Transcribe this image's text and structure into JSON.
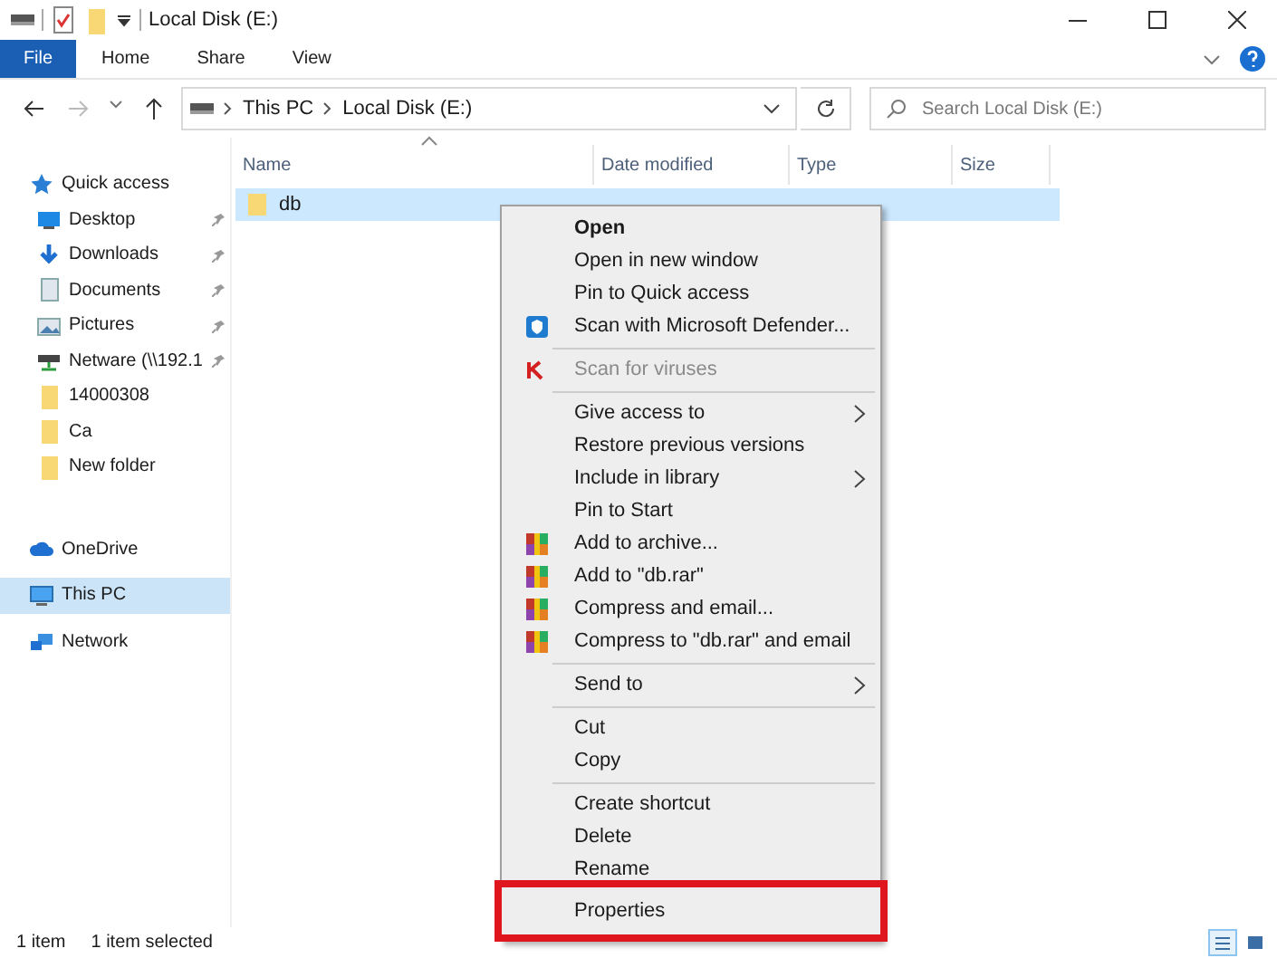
{
  "window": {
    "title": "Local Disk (E:)"
  },
  "ribbon_tabs": [
    {
      "label": "File",
      "selected": true
    },
    {
      "label": "Home",
      "selected": false
    },
    {
      "label": "Share",
      "selected": false
    },
    {
      "label": "View",
      "selected": false
    }
  ],
  "address_bar": {
    "crumbs": [
      "This PC",
      "Local Disk (E:)"
    ]
  },
  "search": {
    "placeholder": "Search Local Disk (E:)"
  },
  "nav_pane": [
    {
      "label": "Quick access",
      "kind": "star",
      "selected": false,
      "children": [
        {
          "label": "Desktop",
          "kind": "desktop",
          "pinned": true,
          "selected": false
        },
        {
          "label": "Downloads",
          "kind": "download",
          "pinned": true,
          "selected": false
        },
        {
          "label": "Documents",
          "kind": "document",
          "pinned": true,
          "selected": false
        },
        {
          "label": "Pictures",
          "kind": "pictures",
          "pinned": true,
          "selected": false
        },
        {
          "label": "Netware (\\\\192.1",
          "kind": "network-drive",
          "pinned": true,
          "selected": false
        },
        {
          "label": "14000308",
          "kind": "folder",
          "pinned": false,
          "selected": false
        },
        {
          "label": "Ca",
          "kind": "folder",
          "pinned": false,
          "selected": false
        },
        {
          "label": "New folder",
          "kind": "folder",
          "pinned": false,
          "selected": false
        }
      ]
    },
    {
      "label": "OneDrive",
      "kind": "cloud",
      "selected": false
    },
    {
      "label": "This PC",
      "kind": "computer",
      "selected": true
    },
    {
      "label": "Network",
      "kind": "network",
      "selected": false
    }
  ],
  "table": {
    "columns": [
      "Name",
      "Date modified",
      "Type",
      "Size"
    ],
    "rows": [
      {
        "name": "db",
        "selected": true
      }
    ]
  },
  "context_menu": [
    {
      "kind": "plain",
      "label": "Open",
      "default": true,
      "disabled": false,
      "submenu": false,
      "highlighted": false
    },
    {
      "kind": "plain",
      "label": "Open in new window",
      "default": false,
      "disabled": false,
      "submenu": false,
      "highlighted": false
    },
    {
      "kind": "plain",
      "label": "Pin to Quick access",
      "default": false,
      "disabled": false,
      "submenu": false,
      "highlighted": false
    },
    {
      "kind": "shield",
      "label": "Scan with Microsoft Defender...",
      "default": false,
      "disabled": false,
      "submenu": false,
      "highlighted": false
    },
    {
      "kind": "separator"
    },
    {
      "kind": "scanner",
      "label": "Scan for viruses",
      "default": false,
      "disabled": true,
      "submenu": false,
      "highlighted": false
    },
    {
      "kind": "separator"
    },
    {
      "kind": "plain",
      "label": "Give access to",
      "default": false,
      "disabled": false,
      "submenu": true,
      "highlighted": false
    },
    {
      "kind": "plain",
      "label": "Restore previous versions",
      "default": false,
      "disabled": false,
      "submenu": false,
      "highlighted": false
    },
    {
      "kind": "plain",
      "label": "Include in library",
      "default": false,
      "disabled": false,
      "submenu": true,
      "highlighted": false
    },
    {
      "kind": "plain",
      "label": "Pin to Start",
      "default": false,
      "disabled": false,
      "submenu": false,
      "highlighted": false
    },
    {
      "kind": "archive",
      "label": "Add to archive...",
      "default": false,
      "disabled": false,
      "submenu": false,
      "highlighted": false
    },
    {
      "kind": "archive",
      "label": "Add to \"db.rar\"",
      "default": false,
      "disabled": false,
      "submenu": false,
      "highlighted": false
    },
    {
      "kind": "archive",
      "label": "Compress and email...",
      "default": false,
      "disabled": false,
      "submenu": false,
      "highlighted": false
    },
    {
      "kind": "archive",
      "label": "Compress to \"db.rar\" and email",
      "default": false,
      "disabled": false,
      "submenu": false,
      "highlighted": false
    },
    {
      "kind": "separator"
    },
    {
      "kind": "plain",
      "label": "Send to",
      "default": false,
      "disabled": false,
      "submenu": true,
      "highlighted": false
    },
    {
      "kind": "separator"
    },
    {
      "kind": "plain",
      "label": "Cut",
      "default": false,
      "disabled": false,
      "submenu": false,
      "highlighted": false
    },
    {
      "kind": "plain",
      "label": "Copy",
      "default": false,
      "disabled": false,
      "submenu": false,
      "highlighted": false
    },
    {
      "kind": "separator"
    },
    {
      "kind": "plain",
      "label": "Create shortcut",
      "default": false,
      "disabled": false,
      "submenu": false,
      "highlighted": false
    },
    {
      "kind": "plain",
      "label": "Delete",
      "default": false,
      "disabled": false,
      "submenu": false,
      "highlighted": false
    },
    {
      "kind": "plain",
      "label": "Rename",
      "default": false,
      "disabled": false,
      "submenu": false,
      "highlighted": false
    },
    {
      "kind": "plain",
      "label": "Properties",
      "default": false,
      "disabled": false,
      "submenu": false,
      "highlighted": true
    }
  ],
  "status_bar": {
    "item_count": "1 item",
    "selection": "1 item selected",
    "views": [
      {
        "kind": "details",
        "selected": true
      },
      {
        "kind": "large-icons",
        "selected": false
      }
    ]
  }
}
